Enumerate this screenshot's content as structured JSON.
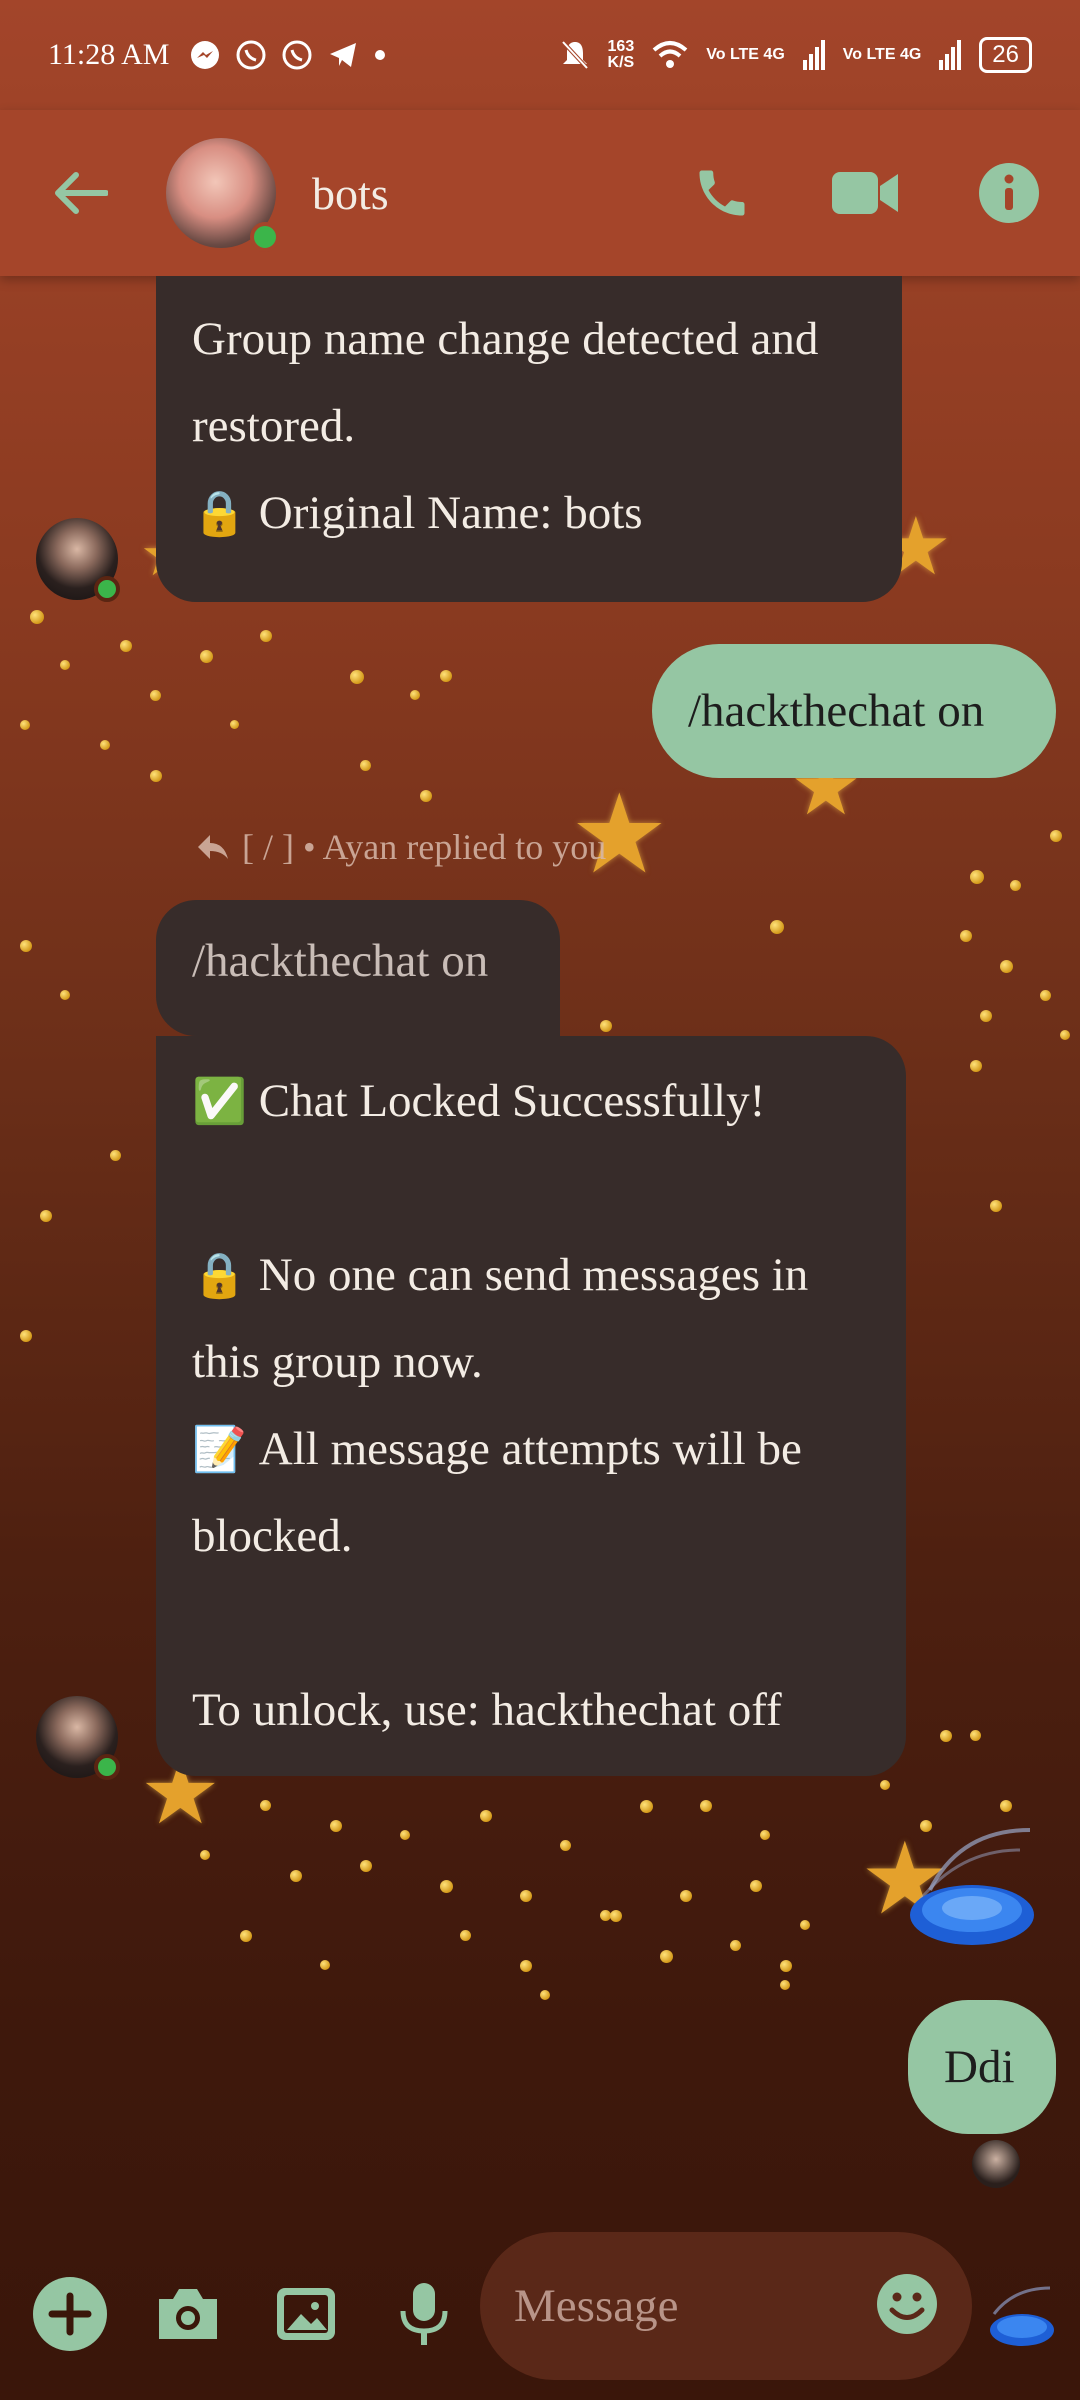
{
  "status_bar": {
    "time": "11:28 AM",
    "net_speed_value": "163",
    "net_speed_unit": "K/S",
    "sim1": "Vo LTE 4G",
    "sim2": "Vo LTE 4G",
    "battery": "26"
  },
  "header": {
    "title": "bots"
  },
  "messages": {
    "m1": {
      "line1": "Group name change detected and",
      "line2": "restored.",
      "line3_emoji": "🔒",
      "line3": "Original Name: bots"
    },
    "m2": {
      "text": "/hackthechat on"
    },
    "reply_meta": "[ / ] • Ayan replied to you",
    "quoted": "/hackthechat on",
    "m3": {
      "line1_emoji": "✅",
      "line1": "Chat Locked Successfully!",
      "line2_emoji": "🔒",
      "line2": "No one can send messages in",
      "line3": "this group now.",
      "line4_emoji": "📝",
      "line4": "All message attempts will be",
      "line5": "blocked.",
      "line6": "To unlock, use: hackthechat off"
    },
    "m4": {
      "text": "Ddi"
    }
  },
  "composer": {
    "placeholder": "Message"
  },
  "colors": {
    "header_bg": "#a5452a",
    "accent": "#95c6a3",
    "incoming_bubble": "#372c2a",
    "online": "#3bb54a"
  },
  "icons": [
    "back-arrow-icon",
    "phone-icon",
    "video-call-icon",
    "info-icon",
    "plus-icon",
    "camera-icon",
    "gallery-icon",
    "microphone-icon",
    "emoji-icon",
    "frisbee-icon"
  ]
}
